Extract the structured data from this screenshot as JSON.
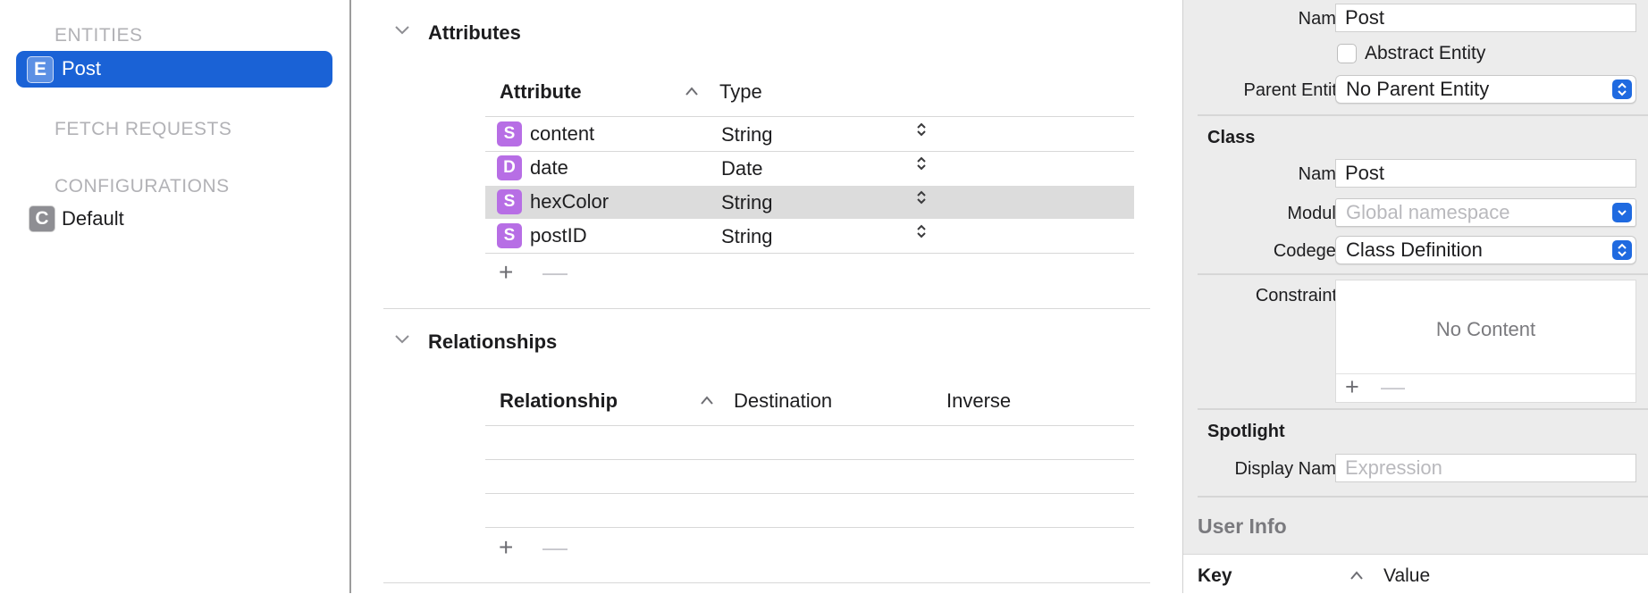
{
  "sidebar": {
    "entities_title": "ENTITIES",
    "entities": [
      {
        "badge": "E",
        "label": "Post"
      }
    ],
    "fetch_requests_title": "FETCH REQUESTS",
    "configurations_title": "CONFIGURATIONS",
    "configurations": [
      {
        "badge": "C",
        "label": "Default"
      }
    ]
  },
  "attributes": {
    "title": "Attributes",
    "col_attribute": "Attribute",
    "col_type": "Type",
    "rows": [
      {
        "badge": "S",
        "name": "content",
        "type": "String"
      },
      {
        "badge": "D",
        "name": "date",
        "type": "Date"
      },
      {
        "badge": "S",
        "name": "hexColor",
        "type": "String",
        "selected": true
      },
      {
        "badge": "S",
        "name": "postID",
        "type": "String"
      }
    ],
    "add_label": "+",
    "remove_label": "—"
  },
  "relationships": {
    "title": "Relationships",
    "col_relationship": "Relationship",
    "col_destination": "Destination",
    "col_inverse": "Inverse",
    "add_label": "+",
    "remove_label": "—"
  },
  "sort_indicator": "^",
  "inspector": {
    "name_label": "Name",
    "name_value": "Post",
    "abstract_label": "Abstract Entity",
    "abstract_checked": false,
    "parent_label": "Parent Entity",
    "parent_value": "No Parent Entity",
    "class_title": "Class",
    "class_name_label": "Name",
    "class_name_value": "Post",
    "module_label": "Module",
    "module_placeholder": "Global namespace",
    "codegen_label": "Codegen",
    "codegen_value": "Class Definition",
    "constraints_label": "Constraints",
    "constraints_empty": "No Content",
    "constraints_add": "+",
    "constraints_remove": "—",
    "spotlight_title": "Spotlight",
    "display_name_label": "Display Name",
    "display_name_placeholder": "Expression",
    "user_info_title": "User Info",
    "key_label": "Key",
    "value_label": "Value"
  },
  "colors": {
    "selection_blue": "#1a62d6",
    "string_badge": "#b76ee5",
    "popup_arrow": "#1f6ae0"
  }
}
